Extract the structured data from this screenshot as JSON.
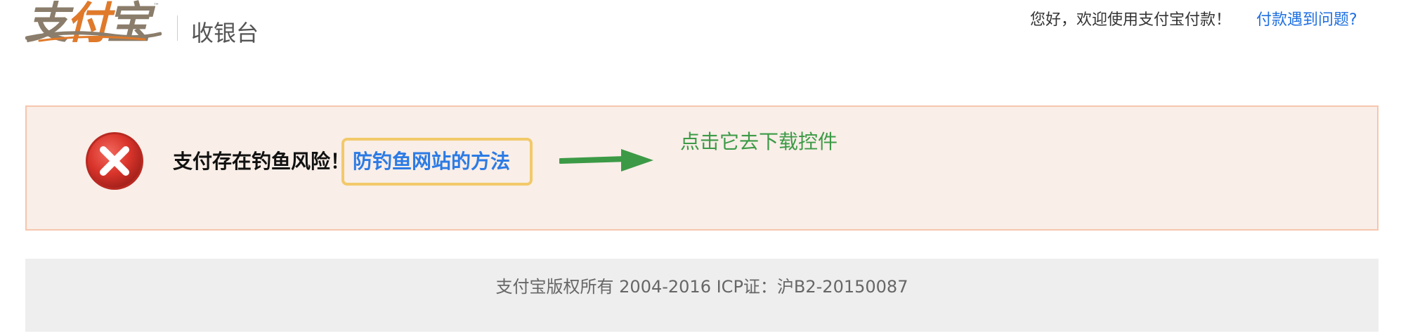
{
  "header": {
    "logo_text": "支付宝",
    "logo_tm": "™",
    "title": "收银台",
    "welcome": "您好，欢迎使用支付宝付款！",
    "help_link": "付款遇到问题?"
  },
  "alert": {
    "message": "支付存在钓鱼风险！",
    "link": "防钓鱼网站的方法",
    "hint": "点击它去下载控件",
    "icon": "error-x-icon",
    "colors": {
      "background": "#f9eee8",
      "border": "#f6c6ad",
      "icon_red": "#d9342b",
      "link": "#2c7be5",
      "highlight_box": "#f2c96a",
      "hint_green": "#3c9a46"
    }
  },
  "footer": {
    "copyright": "支付宝版权所有 2004-2016 ICP证：沪B2-20150087"
  }
}
